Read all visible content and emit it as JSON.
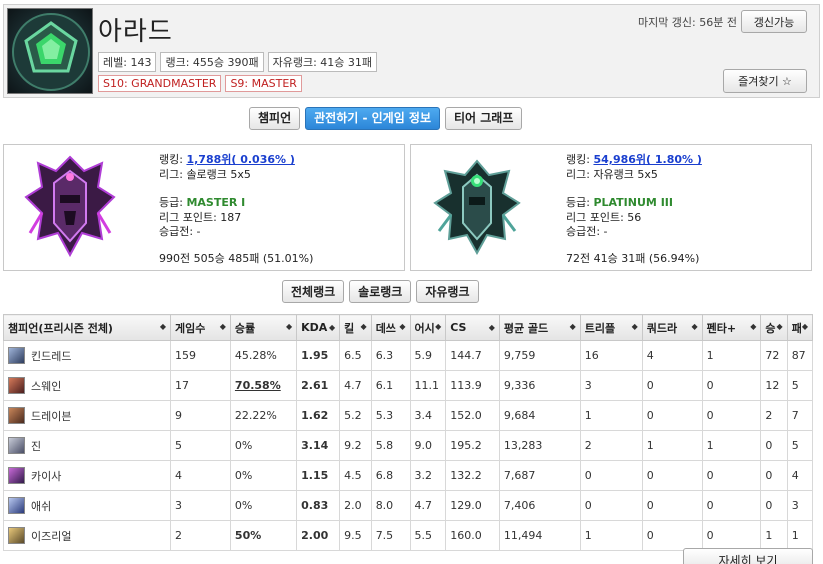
{
  "profile": {
    "summoner_name": "아라드",
    "level": "레벨: 143",
    "rank_record": "랭크: 455승 390패",
    "flex_record": "자유랭크: 41승 31패",
    "seasons": [
      "S10: GRANDMASTER",
      "S9: MASTER"
    ],
    "last_update": "마지막 갱신: 56분 전",
    "refresh_label": "갱신가능",
    "favorite_label": "즐겨찾기 ☆"
  },
  "view_tabs": [
    {
      "label": "챔피언",
      "active": false
    },
    {
      "label": "관전하기 - 인게임 정보",
      "active": true
    },
    {
      "label": "티어 그래프",
      "active": false
    }
  ],
  "solo_rank": {
    "ranking_label": "랭킹:",
    "ranking": "1,788위( 0.036% )",
    "league": "리그: 솔로랭크 5x5",
    "tier_label": "등급:",
    "tier": "MASTER I",
    "points": "리그 포인트: 187",
    "promo": "승급전: -",
    "record": "990전 505승 485패 (51.01%)"
  },
  "flex_rank": {
    "ranking_label": "랭킹:",
    "ranking": "54,986위( 1.80% )",
    "league": "리그: 자유랭크 5x5",
    "tier_label": "등급:",
    "tier": "PLATINUM III",
    "points": "리그 포인트: 56",
    "promo": "승급전: -",
    "record": "72전 41승 31패 (56.94%)"
  },
  "queue_tabs": [
    "전체랭크",
    "솔로랭크",
    "자유랭크"
  ],
  "table": {
    "headers": [
      "챔피언(프리시즌 전체)",
      "게임수",
      "승률",
      "KDA",
      "킬",
      "데쓰",
      "어시",
      "CS",
      "평균 골드",
      "트리플",
      "쿼드라",
      "펜타+",
      "승",
      "패"
    ],
    "rows": [
      {
        "champion": "킨드레드",
        "games": "159",
        "winrate": "45.28%",
        "kda": "1.95",
        "kills": "6.5",
        "deaths": "6.3",
        "assists": "5.9",
        "cs": "144.7",
        "gold": "9,759",
        "triple": "16",
        "quadra": "4",
        "penta": "1",
        "wins": "72",
        "losses": "87"
      },
      {
        "champion": "스웨인",
        "games": "17",
        "winrate": "70.58%",
        "kda": "2.61",
        "kills": "4.7",
        "deaths": "6.1",
        "assists": "11.1",
        "cs": "113.9",
        "gold": "9,336",
        "triple": "3",
        "quadra": "0",
        "penta": "0",
        "wins": "12",
        "losses": "5"
      },
      {
        "champion": "드레이븐",
        "games": "9",
        "winrate": "22.22%",
        "kda": "1.62",
        "kills": "5.2",
        "deaths": "5.3",
        "assists": "3.4",
        "cs": "152.0",
        "gold": "9,684",
        "triple": "1",
        "quadra": "0",
        "penta": "0",
        "wins": "2",
        "losses": "7"
      },
      {
        "champion": "진",
        "games": "5",
        "winrate": "0%",
        "kda": "3.14",
        "kills": "9.2",
        "deaths": "5.8",
        "assists": "9.0",
        "cs": "195.2",
        "gold": "13,283",
        "triple": "2",
        "quadra": "1",
        "penta": "1",
        "wins": "0",
        "losses": "5"
      },
      {
        "champion": "카이사",
        "games": "4",
        "winrate": "0%",
        "kda": "1.15",
        "kills": "4.5",
        "deaths": "6.8",
        "assists": "3.2",
        "cs": "132.2",
        "gold": "7,687",
        "triple": "0",
        "quadra": "0",
        "penta": "0",
        "wins": "0",
        "losses": "4"
      },
      {
        "champion": "애쉬",
        "games": "3",
        "winrate": "0%",
        "kda": "0.83",
        "kills": "2.0",
        "deaths": "8.0",
        "assists": "4.7",
        "cs": "129.0",
        "gold": "7,406",
        "triple": "0",
        "quadra": "0",
        "penta": "0",
        "wins": "0",
        "losses": "3"
      },
      {
        "champion": "이즈리얼",
        "games": "2",
        "winrate": "50%",
        "kda": "2.00",
        "kills": "9.5",
        "deaths": "7.5",
        "assists": "5.5",
        "cs": "160.0",
        "gold": "11,494",
        "triple": "1",
        "quadra": "0",
        "penta": "0",
        "wins": "1",
        "losses": "1"
      }
    ]
  },
  "more_label": "자세히 보기",
  "colors": {
    "accent_blue": "#2c86d8",
    "tier_green": "#2f8a2f",
    "rank_link": "#1a3fcf",
    "season_red": "#c02020"
  }
}
